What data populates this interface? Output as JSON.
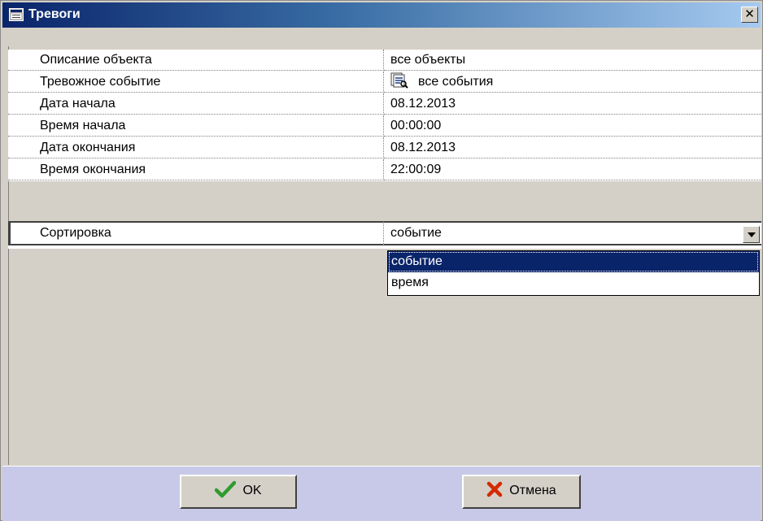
{
  "window": {
    "title": "Тревоги",
    "close_glyph": "✕",
    "title_icon": "window-list-icon"
  },
  "grid": {
    "rows": [
      {
        "label": "Описание объекта",
        "value": "все объекты"
      },
      {
        "label": "Тревожное событие",
        "value": "все события",
        "icon": "events-list-icon"
      },
      {
        "label": "Дата начала",
        "value": "08.12.2013"
      },
      {
        "label": "Время начала",
        "value": "00:00:00"
      },
      {
        "label": "Дата окончания",
        "value": "08.12.2013"
      },
      {
        "label": "Время окончания",
        "value": "22:00:09"
      },
      {
        "label": "Сортировка",
        "value": "событие",
        "selected": true
      }
    ]
  },
  "sort_dropdown": {
    "options": [
      "событие",
      "время"
    ],
    "highlighted": "событие"
  },
  "buttons": {
    "ok_label": "OK",
    "cancel_label": "Отмена"
  },
  "colors": {
    "title_start": "#0a246a",
    "title_end": "#a6caf0",
    "selection": "#0a246a",
    "footer": "#c8c8e8",
    "ok_check": "#2e9b2e",
    "cancel_x": "#d42a00"
  }
}
